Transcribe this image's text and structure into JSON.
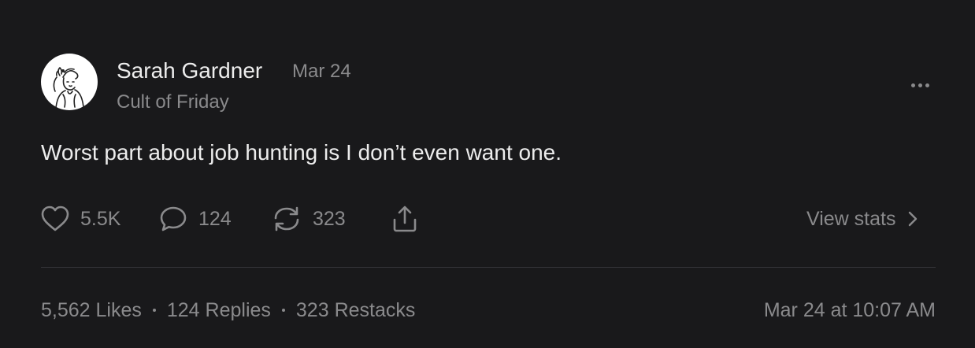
{
  "post": {
    "author": "Sarah Gardner",
    "date": "Mar 24",
    "publication": "Cult of Friday",
    "body": "Worst part about job hunting is I don’t even want one."
  },
  "actions": {
    "likes": "5.5K",
    "comments": "124",
    "restacks": "323",
    "view_stats": "View stats"
  },
  "stats": {
    "likes": "5,562 Likes",
    "replies": "124 Replies",
    "restacks": "323 Restacks",
    "timestamp": "Mar 24 at 10:07 AM"
  },
  "icons": {
    "more": "more-horizontal-icon",
    "like": "heart-icon",
    "comment": "comment-icon",
    "restack": "restack-icon",
    "share": "share-icon",
    "view_stats": "chevron-right-icon"
  },
  "colors": {
    "background": "#19191b",
    "text_primary": "#ededed",
    "text_secondary": "#8a8a8c",
    "divider": "#35353a"
  }
}
